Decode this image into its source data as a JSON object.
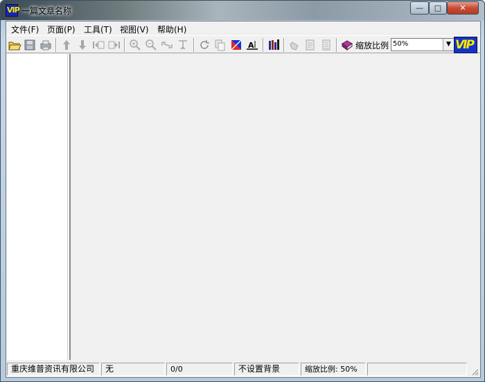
{
  "window": {
    "title": "一篇文章名称",
    "app_icon": "vip-app-icon",
    "app_icon_text": "VIP",
    "caption_buttons": {
      "minimize": "—",
      "maximize": "□",
      "close": "✕"
    }
  },
  "menu": {
    "items": [
      "文件(F)",
      "页面(P)",
      "工具(T)",
      "视图(V)",
      "帮助(H)"
    ]
  },
  "toolbar": {
    "buttons": [
      "open-folder-icon",
      "save-icon",
      "print-icon",
      "page-up-icon",
      "page-down-icon",
      "first-page-icon",
      "last-page-icon",
      "zoom-in-icon",
      "zoom-out-icon",
      "fit-width-icon",
      "fit-page-icon",
      "rotate-icon",
      "copy-icon",
      "color-icon",
      "text-select-icon",
      "library-icon",
      "hand-tool-icon",
      "select-page-icon",
      "document-info-icon",
      "book-icon"
    ],
    "zoom_label": "缩放比例",
    "zoom_value": "50%",
    "logo_text": "VIP"
  },
  "statusbar": {
    "company": "重庆维普资讯有限公司",
    "mode": "无",
    "page": "0/0",
    "background": "不设置背景",
    "zoom": "缩放比例: 50%",
    "extra": ""
  },
  "colors": {
    "client_bg": "#f0f0f0",
    "side_panel_bg": "#ffffff",
    "close_button": "#c74c35",
    "logo_blue": "#1234c8",
    "logo_yellow": "#ffe800"
  }
}
